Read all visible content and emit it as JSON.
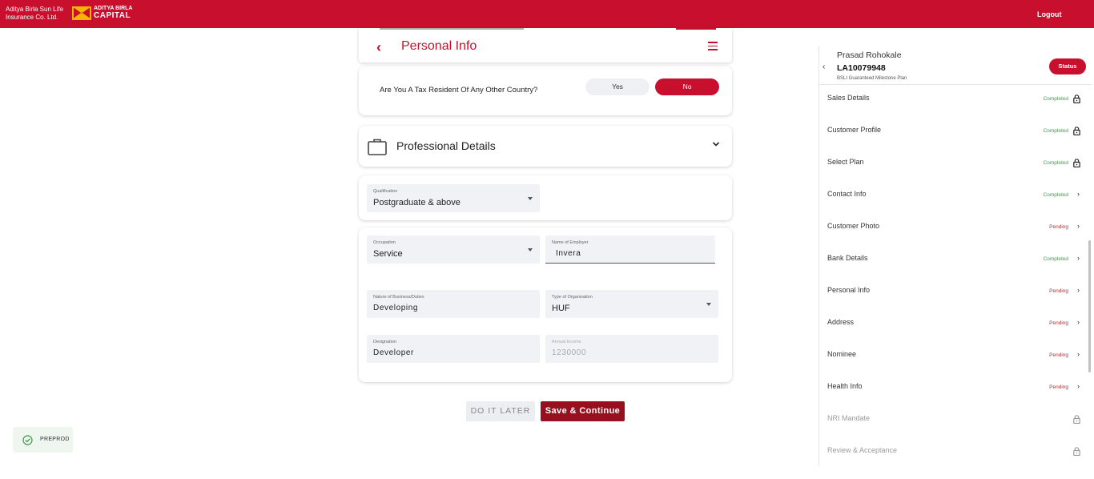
{
  "header": {
    "brand_line1": "Aditya Birla Sun Life",
    "brand_line2": "Insurance Co. Ltd.",
    "brand2_top": "ADITYA BIRLA",
    "brand2_bottom": "CAPITAL",
    "logout_label": "Logout",
    "accent_color": "#c8102e"
  },
  "personal_info": {
    "title": "Personal Info",
    "tax_question": "Are You A Tax Resident Of Any Other Country?",
    "yes_label": "Yes",
    "no_label": "No",
    "selected": "No"
  },
  "professional": {
    "title": "Professional Details",
    "qualification": {
      "label": "Qualification",
      "value": "Postgraduate & above"
    },
    "occupation": {
      "label": "Occupation",
      "value": "Service"
    },
    "employer": {
      "label": "Name of Employer",
      "value": "Invera"
    },
    "nature": {
      "label": "Nature of Business/Duties",
      "value": "Developing"
    },
    "org_type": {
      "label": "Type of Organisation",
      "value": "HUF"
    },
    "designation": {
      "label": "Designation",
      "value": "Developer"
    },
    "annual_income": {
      "label": "Annual Income",
      "value": "1230000"
    }
  },
  "actions": {
    "later_label": "DO IT LATER",
    "save_label": "Save & Continue"
  },
  "env_badge": {
    "label": "PREPROD"
  },
  "sidebar": {
    "name": "Prasad Rohokale",
    "id": "LA10079948",
    "plan": "BSLI Guaranteed Milestone Plan",
    "status_label": "Status",
    "steps": [
      {
        "label": "Sales Details",
        "state": "Completed",
        "icon": "lock-icon"
      },
      {
        "label": "Customer Profile",
        "state": "Completed",
        "icon": "lock-icon"
      },
      {
        "label": "Select Plan",
        "state": "Completed",
        "icon": "lock-icon"
      },
      {
        "label": "Contact Info",
        "state": "Completed",
        "icon": "chevron-right-icon"
      },
      {
        "label": "Customer Photo",
        "state": "Pending",
        "icon": "chevron-right-icon"
      },
      {
        "label": "Bank Details",
        "state": "Completed",
        "icon": "chevron-right-icon"
      },
      {
        "label": "Personal Info",
        "state": "Pending",
        "icon": "chevron-right-icon"
      },
      {
        "label": "Address",
        "state": "Pending",
        "icon": "chevron-right-icon"
      },
      {
        "label": "Nominee",
        "state": "Pending",
        "icon": "chevron-right-icon"
      },
      {
        "label": "Health Info",
        "state": "Pending",
        "icon": "chevron-right-icon"
      },
      {
        "label": "NRI Mandate",
        "state": "",
        "icon": "lock-icon"
      },
      {
        "label": "Review & Acceptance",
        "state": "",
        "icon": "lock-icon"
      }
    ]
  }
}
